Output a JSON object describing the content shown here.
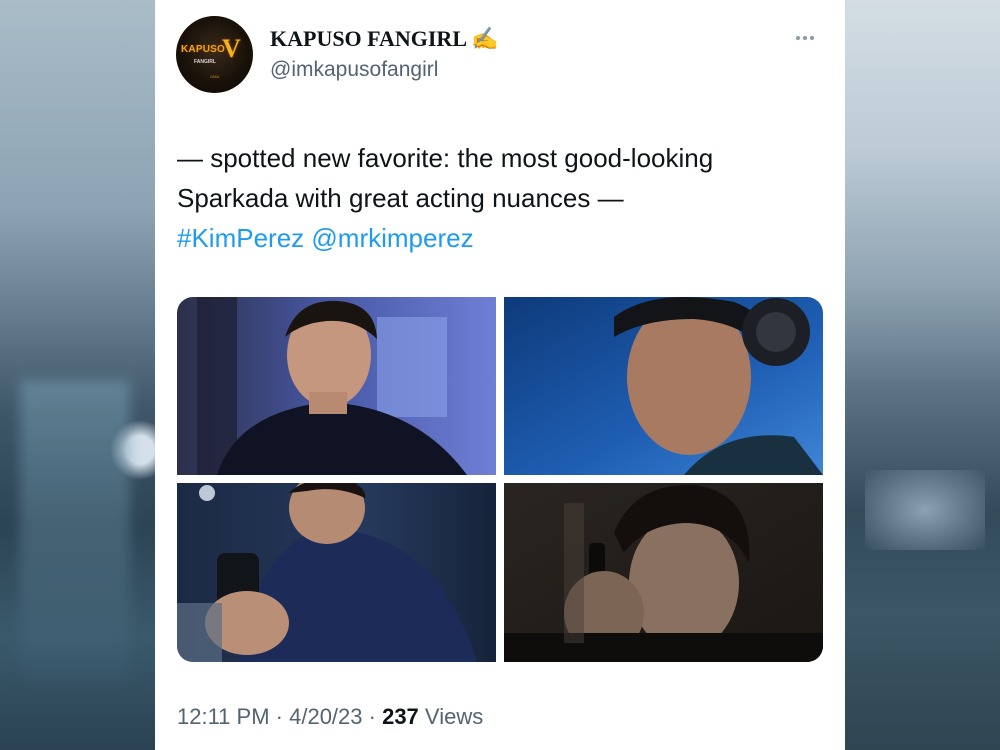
{
  "tweet": {
    "author": {
      "display_name": "KAPUSO FANGIRL",
      "emoji": "✍️",
      "handle": "@imkapusofangirl",
      "avatar_logo": {
        "word": "KAPUSO",
        "letter": "V",
        "sub": "FANGIRL",
        "tiny": "GMA"
      }
    },
    "text": {
      "line1": "— spotted new favorite: the most good-looking",
      "line2": "Sparkada with great acting nuances —",
      "hashtag": "#KimPerez",
      "mention": "@mrkimperez"
    },
    "media": [
      {
        "label": "photo-1"
      },
      {
        "label": "photo-2"
      },
      {
        "label": "photo-3"
      },
      {
        "label": "photo-4"
      }
    ],
    "meta": {
      "time": "12:11 PM",
      "separator": " · ",
      "date": "4/20/23",
      "views_count": "237",
      "views_label": "Views"
    }
  },
  "colors": {
    "link": "#1d9bf0",
    "text": "#0f1419",
    "secondary": "#536471"
  },
  "icons": [
    "more-icon",
    "writing-hand-emoji"
  ]
}
